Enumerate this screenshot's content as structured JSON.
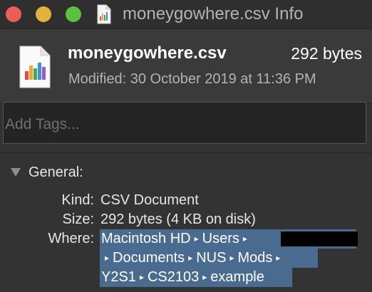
{
  "window": {
    "title": "moneygowhere.csv Info"
  },
  "header": {
    "file_name": "moneygowhere.csv",
    "file_size": "292 bytes",
    "modified": "Modified: 30 October 2019 at 11:36 PM"
  },
  "tags": {
    "placeholder": "Add Tags..."
  },
  "general": {
    "section_label": "General:",
    "kind_label": "Kind:",
    "kind_value": "CSV Document",
    "size_label": "Size:",
    "size_value": "292 bytes (4 KB on disk)",
    "where_label": "Where:",
    "path": [
      "Macintosh HD",
      "Users",
      "",
      "Documents",
      "NUS",
      "Mods",
      "Y2S1",
      "CS2103",
      "example"
    ],
    "path_separator": "▸"
  },
  "colors": {
    "close": "#ec5f56",
    "minimize": "#e2b33b",
    "maximize": "#5bc23f",
    "selection": "#4a6b90",
    "background": "#333333"
  },
  "icons": {
    "file": "numbers-document-icon",
    "disclosure": "disclosure-triangle-down-icon"
  }
}
